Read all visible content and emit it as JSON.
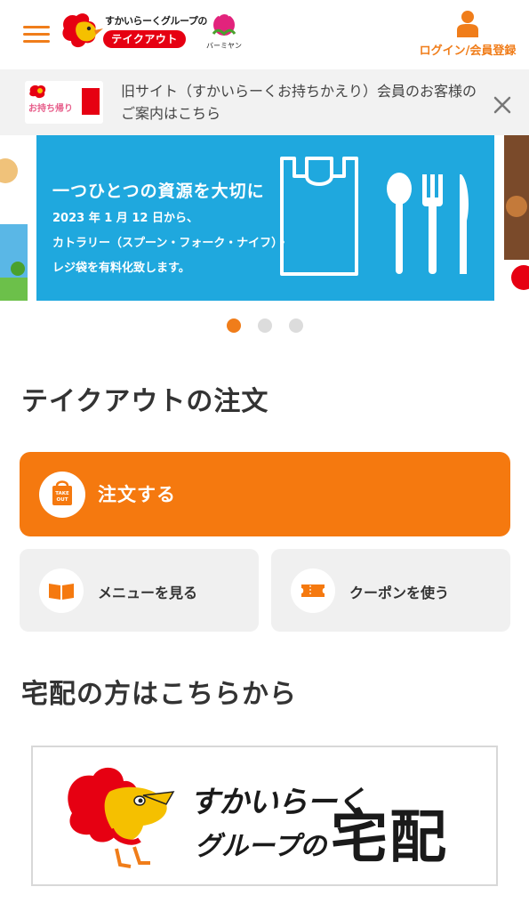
{
  "header": {
    "menu_icon": "hamburger-icon",
    "brand_name": "すかいらーくグループの",
    "brand_service": "テイクアウト",
    "sub_brand": "バーミヤン",
    "login_label": "ログイン/会員登録",
    "login_icon": "user-icon",
    "accent_color": "#f07d1a"
  },
  "notice": {
    "thumb_text": "お持ち帰り",
    "text": "旧サイト（すかいらーくお持ちかえり）会員のお客様のご案内はこちら",
    "close_icon": "close-icon"
  },
  "carousel": {
    "slide": {
      "title": "一つひとつの資源を大切に",
      "line1": "2023 年 1 月 12 日から、",
      "line2": "カトラリー（スプーン・フォーク・ナイフ）・",
      "line3": "レジ袋を有料化致します。"
    },
    "dot_count": 3,
    "active_dot": 1
  },
  "takeout": {
    "title": "テイクアウトの注文",
    "order_label": "注文する",
    "order_icon_text_top": "TAKE",
    "order_icon_text_bottom": "OUT",
    "menu_label": "メニューを見る",
    "menu_icon": "book-icon",
    "coupon_label": "クーポンを使う",
    "coupon_icon": "ticket-icon"
  },
  "delivery": {
    "title": "宅配の方はこちらから",
    "banner_line1": "すかいらーく",
    "banner_line2": "グループの",
    "banner_big": "宅配"
  }
}
